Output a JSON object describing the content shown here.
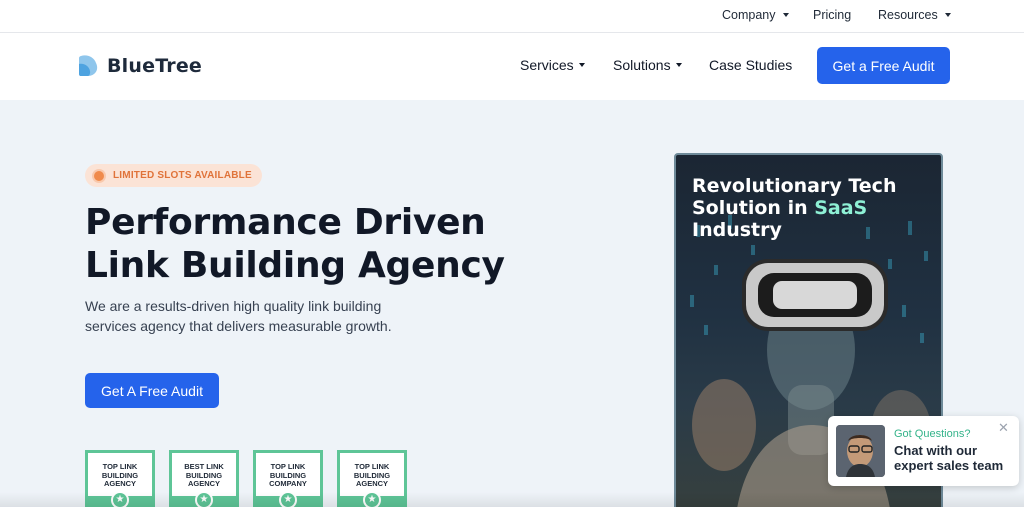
{
  "topbar": {
    "items": [
      {
        "label": "Company",
        "dropdown": true
      },
      {
        "label": "Pricing",
        "dropdown": false
      },
      {
        "label": "Resources",
        "dropdown": true
      }
    ]
  },
  "header": {
    "logo_text": "BlueTree",
    "nav": [
      {
        "label": "Services",
        "dropdown": true
      },
      {
        "label": "Solutions",
        "dropdown": true
      },
      {
        "label": "Case Studies",
        "dropdown": false
      }
    ],
    "cta_label": "Get a Free Audit"
  },
  "hero": {
    "badge": "LIMITED SLOTS AVAILABLE",
    "title_line1": "Performance Driven",
    "title_line2": "Link Building Agency",
    "subtitle_line1": "We are a results-driven high quality link building",
    "subtitle_line2": "services agency that delivers measurable growth.",
    "cta_label": "Get A Free Audit",
    "awards": [
      {
        "line1": "TOP LINK",
        "line2": "BUILDING",
        "line3": "AGENCY"
      },
      {
        "line1": "BEST LINK",
        "line2": "BUILDING",
        "line3": "AGENCY"
      },
      {
        "line1": "TOP LINK",
        "line2": "BUILDING",
        "line3": "COMPANY"
      },
      {
        "line1": "TOP LINK",
        "line2": "BUILDING",
        "line3": "AGENCY"
      }
    ]
  },
  "video": {
    "title_line1": "Revolutionary Tech",
    "title_line2_a": "Solution in ",
    "title_line2_b": "SaaS",
    "title_line3": "Industry"
  },
  "chat": {
    "question": "Got Questions?",
    "message_line1": "Chat with our",
    "message_line2": "expert sales team",
    "close_icon": "close-icon"
  },
  "colors": {
    "brand_blue": "#2563eb",
    "hero_bg": "#eef3f8",
    "badge_orange": "#e0733a",
    "award_green": "#5ec597",
    "saas_highlight": "#8ef0d5"
  }
}
